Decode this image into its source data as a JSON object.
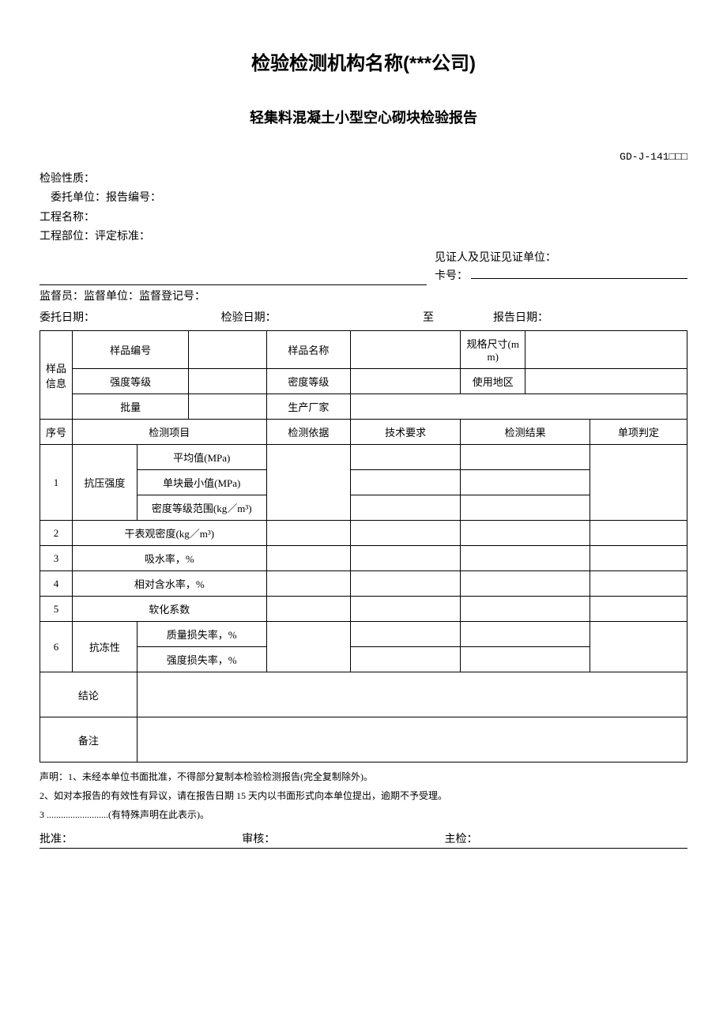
{
  "header": {
    "title": "检验检测机构名称(***公司)",
    "subtitle": "轻集料混凝土小型空心砌块检验报告",
    "form_code": "GD-J-141□□□"
  },
  "meta": {
    "inspect_nature": "检验性质：",
    "entrust_unit": "委托单位：报告编号：",
    "project_name": "工程名称：",
    "project_part": "工程部位：评定标准：",
    "witness_label1": "见证人及见证见证单位：",
    "witness_label2": "卡号：",
    "supervisor": "监督员：监督单位：监督登记号：",
    "dates": {
      "entrust": "委托日期：",
      "inspect": "检验日期：",
      "to": "至",
      "report": "报告日期："
    }
  },
  "sample": {
    "group": "样品信息",
    "row1": {
      "a": "样品编号",
      "b": "样品名称",
      "c": "规格尺寸(mm)"
    },
    "row2": {
      "a": "强度等级",
      "b": "密度等级",
      "c": "使用地区"
    },
    "row3": {
      "a": "批量",
      "b": "生产厂家"
    }
  },
  "cols": {
    "seq": "序号",
    "item": "检测项目",
    "basis": "检测依据",
    "req": "技术要求",
    "result": "检测结果",
    "judge": "单项判定"
  },
  "items": {
    "r1": {
      "no": "1",
      "name": "抗压强度",
      "sub1": "平均值(MPa)",
      "sub2": "单块最小值(MPa)",
      "sub3": "密度等级范围(kg／m³)"
    },
    "r2": {
      "no": "2",
      "name": "干表观密度(kg／m³)"
    },
    "r3": {
      "no": "3",
      "name": "吸水率，%"
    },
    "r4": {
      "no": "4",
      "name": "相对含水率，%"
    },
    "r5": {
      "no": "5",
      "name": "软化系数"
    },
    "r6": {
      "no": "6",
      "name": "抗冻性",
      "sub1": "质量损失率，%",
      "sub2": "强度损失率，%"
    }
  },
  "footer_rows": {
    "conclusion": "结论",
    "remark": "备注"
  },
  "declaration": {
    "l1": "声明：1、未经本单位书面批准，不得部分复制本检验检测报告(完全复制除外)。",
    "l2": "2、如对本报告的有效性有异议，请在报告日期 15 天内以书面形式向本单位提出，逾期不予受理。",
    "l3": "3 ..........................(有特殊声明在此表示)。"
  },
  "signatures": {
    "approve": "批准：",
    "review": "审核：",
    "chief": "主检："
  }
}
